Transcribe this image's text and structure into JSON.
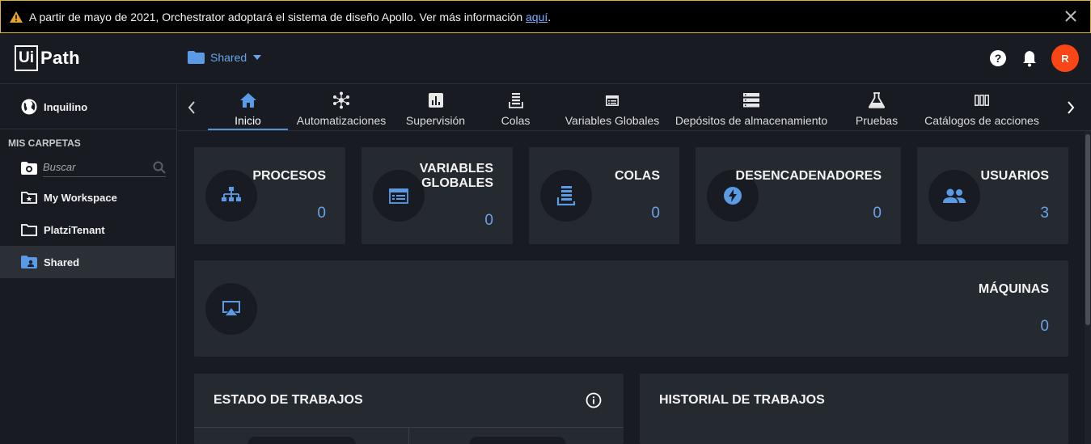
{
  "banner": {
    "message": "A partir de mayo de 2021, Orchestrator adoptará el sistema de diseño Apollo. Ver más información ",
    "link_text": "aquí",
    "suffix": "."
  },
  "header": {
    "logo_ui": "Ui",
    "logo_path": "Path",
    "folder_selector": "Shared",
    "avatar_initial": "R"
  },
  "sidebar": {
    "tenant": "Inquilino",
    "section_title": "MIS CARPETAS",
    "search_placeholder": "Buscar",
    "folders": [
      {
        "label": "My Workspace",
        "icon": "workspace-folder-icon"
      },
      {
        "label": "PlatziTenant",
        "icon": "folder-icon"
      },
      {
        "label": "Shared",
        "icon": "shared-folder-icon",
        "active": true
      }
    ]
  },
  "tabs": [
    {
      "label": "Inicio",
      "icon": "home-icon",
      "active": true
    },
    {
      "label": "Automatizaciones",
      "icon": "automations-icon"
    },
    {
      "label": "Supervisión",
      "icon": "monitoring-icon"
    },
    {
      "label": "Colas",
      "icon": "queues-icon"
    },
    {
      "label": "Variables Globales",
      "icon": "global-variables-icon"
    },
    {
      "label": "Depósitos de almacenamiento",
      "icon": "storage-buckets-icon"
    },
    {
      "label": "Pruebas",
      "icon": "testing-icon"
    },
    {
      "label": "Catálogos de acciones",
      "icon": "action-catalogs-icon"
    }
  ],
  "stats": [
    {
      "title": "PROCESOS",
      "value": "0",
      "icon": "processes-icon"
    },
    {
      "title_line1": "VARIABLES",
      "title_line2": "GLOBALES",
      "value": "0",
      "icon": "assets-icon"
    },
    {
      "title": "COLAS",
      "value": "0",
      "icon": "queues-icon"
    },
    {
      "title": "DESENCADENADORES",
      "value": "0",
      "icon": "triggers-icon"
    },
    {
      "title": "USUARIOS",
      "value": "3",
      "icon": "users-icon"
    }
  ],
  "machines": {
    "title": "MÁQUINAS",
    "value": "0",
    "icon": "machines-icon"
  },
  "jobs_status": {
    "title": "ESTADO DE TRABAJOS"
  },
  "jobs_history": {
    "title": "HISTORIAL DE TRABAJOS"
  },
  "colors": {
    "accent": "#6aa3ea",
    "avatar": "#fa4616",
    "banner_border": "#e2b33a",
    "card": "#252a31",
    "background": "#181c22"
  }
}
